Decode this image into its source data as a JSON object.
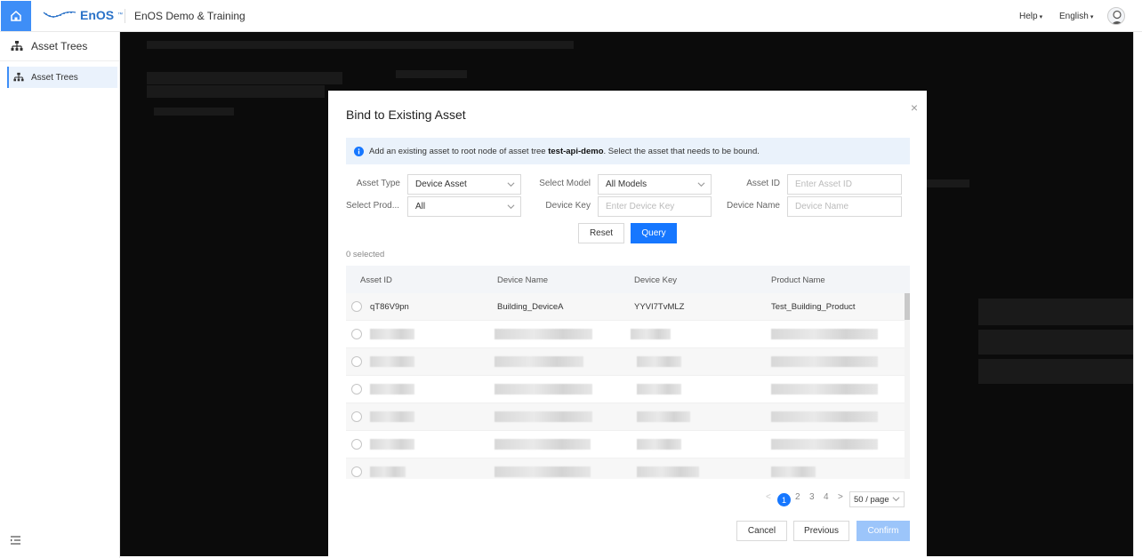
{
  "header": {
    "logo_text": "EnOS",
    "logo_tm": "™",
    "app_title": "EnOS Demo & Training",
    "help_label": "Help",
    "language_label": "English",
    "caret": "▾"
  },
  "sidebar": {
    "title": "Asset Trees",
    "items": [
      {
        "label": "Asset Trees"
      }
    ]
  },
  "modal": {
    "title": "Bind to Existing Asset",
    "close_glyph": "×",
    "info": {
      "prefix": "Add an existing asset to root node of asset tree",
      "tree_name": "test-api-demo",
      "suffix": ". Select the asset that needs to be bound."
    },
    "filters": {
      "asset_type_label": "Asset Type",
      "asset_type_value": "Device Asset",
      "select_model_label": "Select Model",
      "select_model_value": "All Models",
      "asset_id_label": "Asset ID",
      "asset_id_placeholder": "Enter Asset ID",
      "select_product_label": "Select Prod...",
      "select_product_value": "All",
      "device_key_label": "Device Key",
      "device_key_placeholder": "Enter Device Key",
      "device_name_label": "Device Name",
      "device_name_placeholder": "Device Name"
    },
    "reset_label": "Reset",
    "query_label": "Query",
    "selected_count": "0 selected",
    "table": {
      "columns": [
        "Asset ID",
        "Device Name",
        "Device Key",
        "Product Name"
      ],
      "rows": [
        [
          "qT86V9pn",
          "Building_DeviceA",
          "YYVI7TvMLZ",
          "Test_Building_Product"
        ]
      ],
      "redacted_row_count": 6
    },
    "pagination": {
      "prev": "<",
      "current": "1",
      "pages": [
        "2",
        "3",
        "4"
      ],
      "next": ">",
      "page_size": "50 / page"
    },
    "footer": {
      "cancel_label": "Cancel",
      "previous_label": "Previous",
      "confirm_label": "Confirm"
    }
  },
  "colors": {
    "primary": "#1677ff",
    "header_home": "#3e8ef7",
    "info_bg": "#eaf2fb",
    "overlay": "#0b0b0b"
  },
  "icons": {
    "home": "home-icon",
    "tree": "tree-icon",
    "info": "info-icon",
    "avatar": "user-avatar-icon",
    "collapse": "collapse-menu-icon"
  }
}
